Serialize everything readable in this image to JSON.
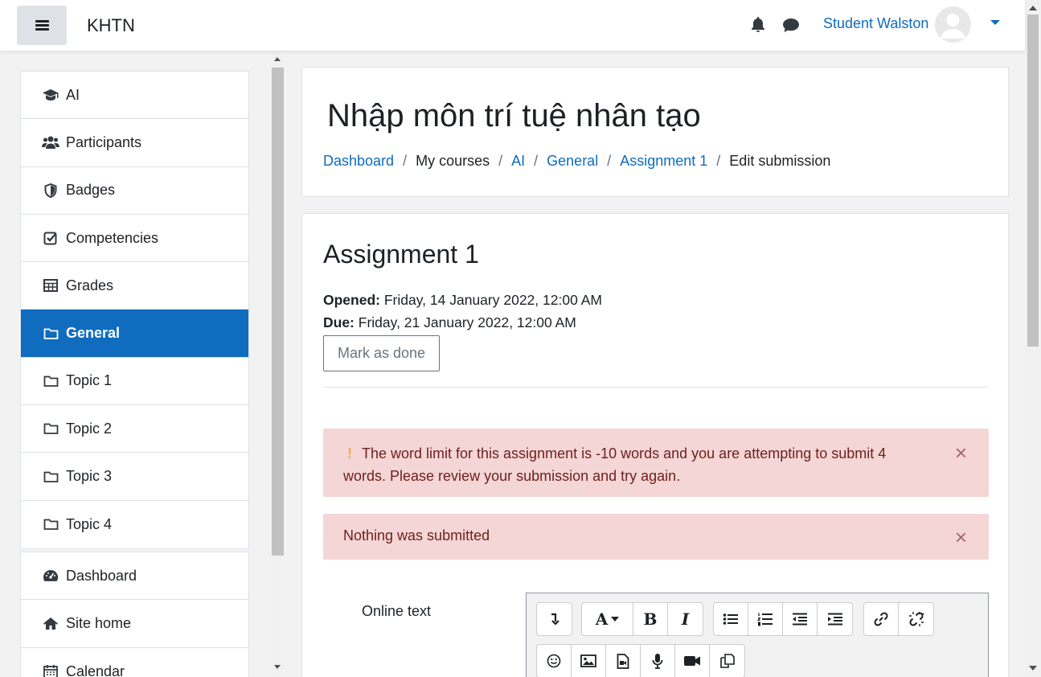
{
  "navbar": {
    "brand": "KHTN",
    "user_name": "Student Walston",
    "icons": [
      "menu-icon",
      "bell-icon",
      "chat-icon",
      "avatar",
      "caret-down-icon"
    ]
  },
  "drawer": {
    "course_items": [
      {
        "label": "AI",
        "icon": "graduation-cap-icon"
      },
      {
        "label": "Participants",
        "icon": "users-icon"
      },
      {
        "label": "Badges",
        "icon": "shield-icon"
      },
      {
        "label": "Competencies",
        "icon": "checkbox-icon"
      },
      {
        "label": "Grades",
        "icon": "table-icon"
      },
      {
        "label": "General",
        "icon": "folder-icon",
        "active": true
      },
      {
        "label": "Topic 1",
        "icon": "folder-icon"
      },
      {
        "label": "Topic 2",
        "icon": "folder-icon"
      },
      {
        "label": "Topic 3",
        "icon": "folder-icon"
      },
      {
        "label": "Topic 4",
        "icon": "folder-icon"
      }
    ],
    "site_items": [
      {
        "label": "Dashboard",
        "icon": "tachometer-icon"
      },
      {
        "label": "Site home",
        "icon": "home-icon"
      },
      {
        "label": "Calendar",
        "icon": "calendar-icon"
      }
    ]
  },
  "header": {
    "course_title": "Nhập môn trí tuệ nhân tạo",
    "breadcrumb": [
      {
        "label": "Dashboard",
        "link": true
      },
      {
        "label": "My courses",
        "link": false
      },
      {
        "label": "AI",
        "link": true
      },
      {
        "label": "General",
        "link": true
      },
      {
        "label": "Assignment 1",
        "link": true
      },
      {
        "label": "Edit submission",
        "link": false
      }
    ],
    "separator": "/"
  },
  "assignment": {
    "title": "Assignment 1",
    "opened_label": "Opened:",
    "opened_value": "Friday, 14 January 2022, 12:00 AM",
    "due_label": "Due:",
    "due_value": "Friday, 21 January 2022, 12:00 AM",
    "mark_done_label": "Mark as done"
  },
  "alerts": [
    {
      "icon": "!",
      "text": "The word limit for this assignment is -10 words and you are attempting to submit 4 words. Please review your submission and try again.",
      "close": "×"
    },
    {
      "text": "Nothing was submitted",
      "close": "×"
    }
  ],
  "form": {
    "online_text_label": "Online text"
  },
  "editor_toolbar": {
    "row1": [
      [
        "collapse-toggle-icon"
      ],
      [
        "font-style-icon",
        "bold-icon",
        "italic-icon"
      ],
      [
        "unordered-list-icon",
        "ordered-list-icon",
        "outdent-icon",
        "indent-icon"
      ],
      [
        "link-icon",
        "unlink-icon"
      ]
    ],
    "row2": [
      "emoji-icon",
      "image-icon",
      "media-file-icon",
      "record-audio-icon",
      "record-video-icon",
      "manage-files-icon"
    ],
    "glyphs": {
      "font": "A",
      "bold": "B",
      "italic": "I"
    }
  },
  "colors": {
    "primary": "#0f6cbf",
    "alert_bg": "#f4d6d6",
    "alert_text": "#6e211e",
    "warn": "#f0ad4e"
  }
}
